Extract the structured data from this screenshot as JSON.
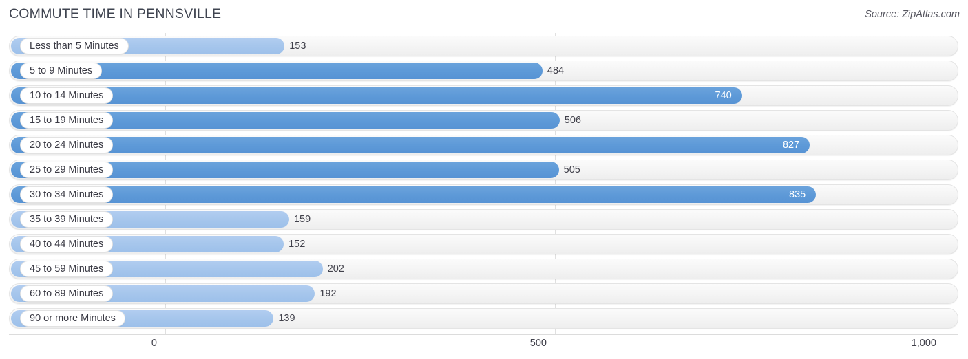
{
  "header": {
    "title": "COMMUTE TIME IN PENNSVILLE",
    "source": "Source: ZipAtlas.com"
  },
  "colors": {
    "bar_light": "#a6c6ec",
    "bar_dark": "#5e9ad8",
    "track": "#f4f4f4",
    "grid": "#e0e0e0",
    "text": "#41414b",
    "value_inside": "#ffffff"
  },
  "chart_data": {
    "type": "bar",
    "orientation": "horizontal",
    "title": "COMMUTE TIME IN PENNSVILLE",
    "subtitle": "",
    "xlabel": "",
    "ylabel": "",
    "xlim": [
      0,
      1000
    ],
    "grid": true,
    "legend": false,
    "xticks": [
      0,
      500,
      1000
    ],
    "xtick_labels": [
      "0",
      "500",
      "1,000"
    ],
    "categories": [
      "Less than 5 Minutes",
      "5 to 9 Minutes",
      "10 to 14 Minutes",
      "15 to 19 Minutes",
      "20 to 24 Minutes",
      "25 to 29 Minutes",
      "30 to 34 Minutes",
      "35 to 39 Minutes",
      "40 to 44 Minutes",
      "45 to 59 Minutes",
      "60 to 89 Minutes",
      "90 or more Minutes"
    ],
    "values": [
      153,
      484,
      740,
      506,
      827,
      505,
      835,
      159,
      152,
      202,
      192,
      139
    ],
    "value_labels": [
      "153",
      "484",
      "740",
      "506",
      "827",
      "505",
      "835",
      "159",
      "152",
      "202",
      "192",
      "139"
    ]
  },
  "rows": [
    {
      "label": "Less than 5 Minutes",
      "value": 153,
      "value_label": "153",
      "shade": "light",
      "label_inside": false
    },
    {
      "label": "5 to 9 Minutes",
      "value": 484,
      "value_label": "484",
      "shade": "dark",
      "label_inside": false
    },
    {
      "label": "10 to 14 Minutes",
      "value": 740,
      "value_label": "740",
      "shade": "dark",
      "label_inside": true
    },
    {
      "label": "15 to 19 Minutes",
      "value": 506,
      "value_label": "506",
      "shade": "dark",
      "label_inside": false
    },
    {
      "label": "20 to 24 Minutes",
      "value": 827,
      "value_label": "827",
      "shade": "dark",
      "label_inside": true
    },
    {
      "label": "25 to 29 Minutes",
      "value": 505,
      "value_label": "505",
      "shade": "dark",
      "label_inside": false
    },
    {
      "label": "30 to 34 Minutes",
      "value": 835,
      "value_label": "835",
      "shade": "dark",
      "label_inside": true
    },
    {
      "label": "35 to 39 Minutes",
      "value": 159,
      "value_label": "159",
      "shade": "light",
      "label_inside": false
    },
    {
      "label": "40 to 44 Minutes",
      "value": 152,
      "value_label": "152",
      "shade": "light",
      "label_inside": false
    },
    {
      "label": "45 to 59 Minutes",
      "value": 202,
      "value_label": "202",
      "shade": "light",
      "label_inside": false
    },
    {
      "label": "60 to 89 Minutes",
      "value": 192,
      "value_label": "192",
      "shade": "light",
      "label_inside": false
    },
    {
      "label": "90 or more Minutes",
      "value": 139,
      "value_label": "139",
      "shade": "light",
      "label_inside": false
    }
  ],
  "axis": {
    "ticks": [
      {
        "label": "0",
        "value": 0
      },
      {
        "label": "500",
        "value": 500
      },
      {
        "label": "1,000",
        "value": 1000
      }
    ]
  }
}
